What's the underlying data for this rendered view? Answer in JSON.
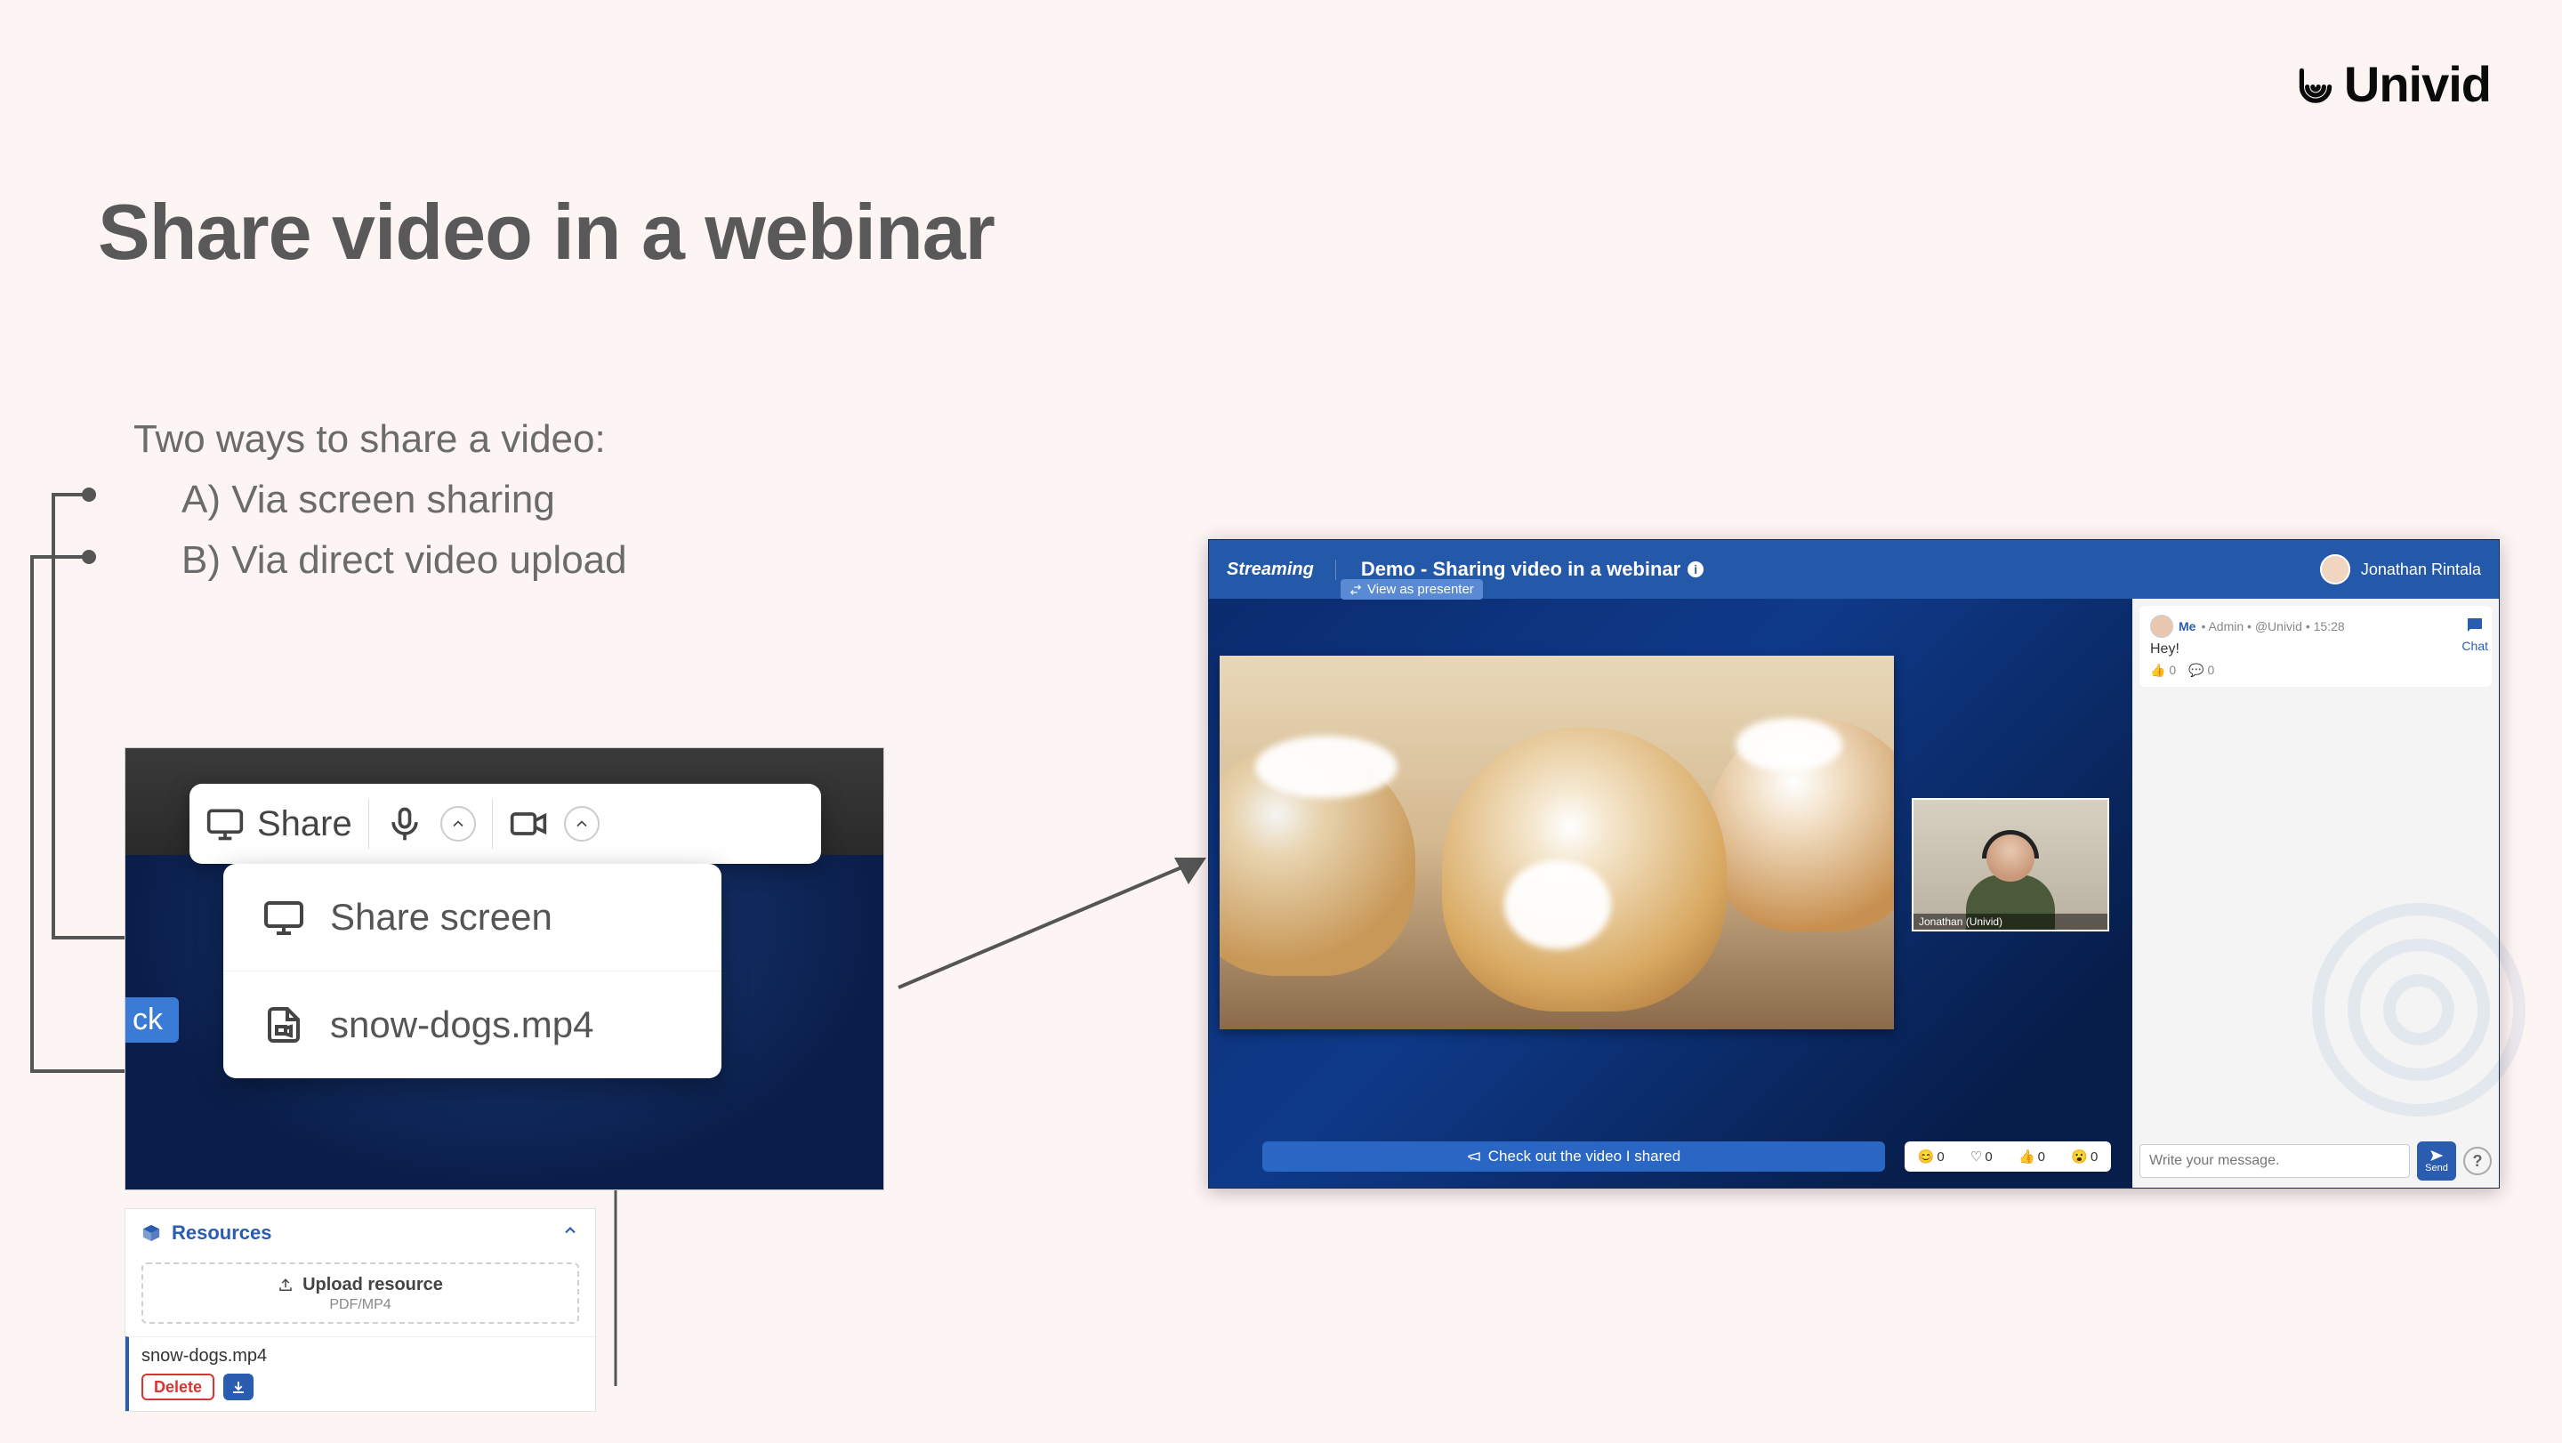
{
  "brand": {
    "name": "Univid"
  },
  "title": "Share video in a webinar",
  "intro": {
    "lead": "Two ways to share a video:",
    "a": "A)  Via screen sharing",
    "b": "B)  Via direct video upload"
  },
  "shotA": {
    "share_label": "Share",
    "ck_fragment": "ck",
    "menu": {
      "share_screen": "Share screen",
      "file": "snow-dogs.mp4"
    }
  },
  "resources": {
    "title": "Resources",
    "upload_title": "Upload resource",
    "upload_sub": "PDF/MP4",
    "file": "snow-dogs.mp4",
    "delete": "Delete"
  },
  "shotB": {
    "streaming": "Streaming",
    "title": "Demo - Sharing video in a webinar",
    "view_as": "View as presenter",
    "user_name": "Jonathan Rintala",
    "pip_label": "Jonathan (Univid)",
    "banner": "Check out the video I shared",
    "reactions": [
      {
        "icon": "😊",
        "count": 0
      },
      {
        "icon": "♡",
        "count": 0
      },
      {
        "icon": "👍",
        "count": 0
      },
      {
        "icon": "😮",
        "count": 0
      }
    ],
    "chat": {
      "label": "Chat",
      "msg": {
        "author": "Me",
        "meta": "• Admin • @Univid • 15:28",
        "body": "Hey!",
        "likes": 0,
        "replies": 0
      },
      "compose_placeholder": "Write your message.",
      "send": "Send",
      "help": "?"
    }
  }
}
